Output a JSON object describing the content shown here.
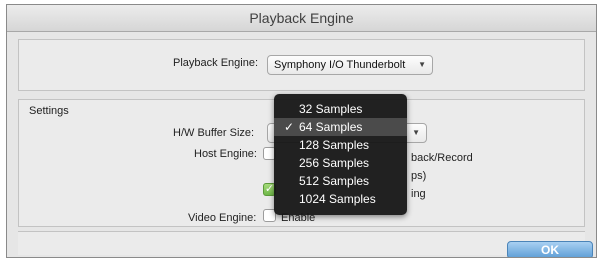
{
  "window": {
    "title": "Playback Engine"
  },
  "engine": {
    "label": "Playback Engine:",
    "value": "Symphony I/O Thunderbolt"
  },
  "settings": {
    "section_label": "Settings",
    "buffer_label": "H/W Buffer Size:",
    "buffer_value_partial": "64",
    "host_engine_label": "Host Engine:",
    "host_engine_text_partial": "back/Record",
    "host_engine_text_partial_2": "ps)",
    "host_engine_text_partial_3": "ing",
    "video_engine_label": "Video Engine:",
    "video_engine_text_partial": "Enable"
  },
  "dropdown": {
    "items": [
      "32 Samples",
      "64 Samples",
      "128 Samples",
      "256 Samples",
      "512 Samples",
      "1024 Samples"
    ],
    "selected_index": 1,
    "check_glyph": "✓"
  },
  "footer": {
    "ok_label": "OK"
  },
  "icons": {
    "caret": "▼",
    "check": "✓"
  }
}
